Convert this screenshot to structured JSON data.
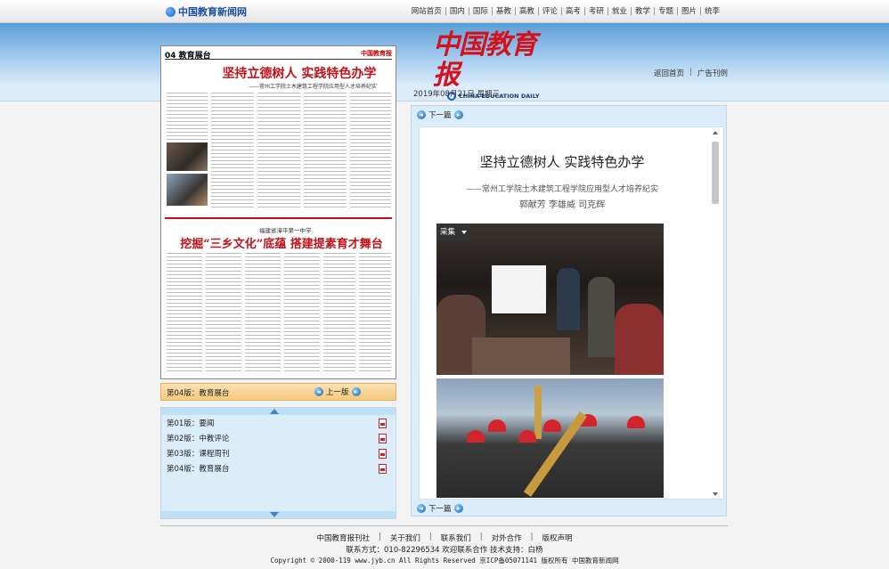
{
  "site": {
    "logo_text": "中国教育新闻网"
  },
  "topnav": [
    "网站首页",
    "国内",
    "国际",
    "基教",
    "高教",
    "评论",
    "高考",
    "考研",
    "就业",
    "教学",
    "专题",
    "图片",
    "统李"
  ],
  "masthead": {
    "cn": "中国教育报",
    "en": "CHINA EDUCATION DAILY"
  },
  "header_links": {
    "home": "返回首页",
    "ads": "广告刊例",
    "sep": "|"
  },
  "date": "2019年08月21日  星期三",
  "paper": {
    "page_label": "04 教育展台",
    "paper_name": "中国教育报",
    "headline1": "坚持立德树人   实践特色办学",
    "sub1": "——常州工学院土木建筑工程学院应用型人才培养纪实",
    "kicker2": "福建省漳平第一中学",
    "headline2": "挖掘“三乡文化”底蕴   搭建提素育才舞台"
  },
  "pagebar": {
    "current": "第04版：教育展台",
    "prev": "上一版"
  },
  "pagelist": [
    {
      "label": "第01版：要闻"
    },
    {
      "label": "第02版：中教评论"
    },
    {
      "label": "第03版：课程周刊"
    },
    {
      "label": "第04版：教育展台"
    }
  ],
  "article": {
    "next_top": "下一篇",
    "next_bottom": "下一篇",
    "title": "坚持立德树人   实践特色办学",
    "subtitle": "——常州工学院土木建筑工程学院应用型人才培养纪实",
    "authors": "郭献芳   李雄威   司克辉",
    "collect": "采集"
  },
  "footer": {
    "links": [
      "中国教育报刊社",
      "关于我们",
      "联系我们",
      "对外合作",
      "版权声明"
    ],
    "sep": "|",
    "contact": "联系方式：010-82296534 欢迎联系合作 技术支持：白杨",
    "copyright": "Copyright © 2000-119 www.jyb.cn All Rights Reserved 京ICP备05071141 版权所有 中国教育新闻网"
  }
}
